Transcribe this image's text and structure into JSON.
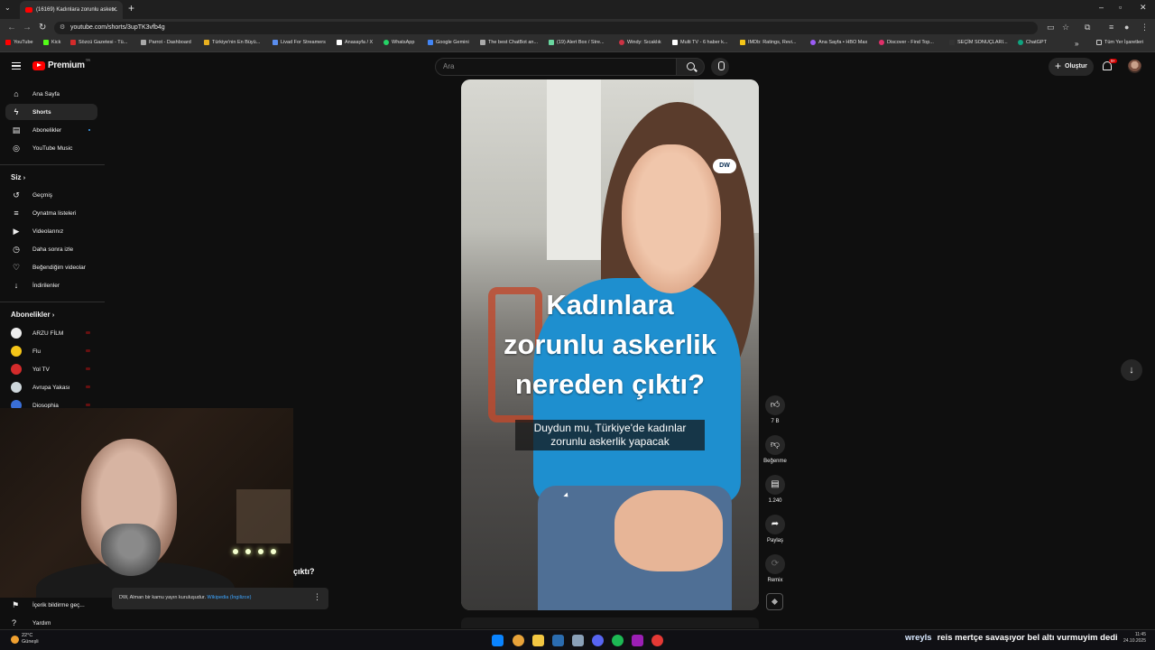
{
  "browser": {
    "tab_title": "(16169) Kadınlara zorunlu asker...",
    "url": "youtube.com/shorts/3upTK3vfb4g",
    "bookmarks": [
      "YouTube",
      "Kick",
      "Sözcü Gazetesi - Tü...",
      "Parrot - Dashboard",
      "Türkiye'nin En Büyü...",
      "Livad For Streamers",
      "Anasayfa / X",
      "WhatsApp",
      "Google Gemini",
      "The best ChatBot an...",
      "(19) Alert Box / Stre...",
      "Windy: Sıcaklık",
      "Multi TV - 6 haber k...",
      "IMDb: Ratings, Revi...",
      "Ana Sayfa • HBO Max",
      "Discover - Find Top...",
      "SEÇİM SONUÇLARI...",
      "ChatGPT"
    ],
    "all_bookmarks": "Tüm Yer İşaretleri",
    "bookmark_colors": [
      "#ff0000",
      "#53fc18",
      "#d42b2b",
      "#aaaaaa",
      "#e8b020",
      "#5a8dee",
      "#ffffff",
      "#25d366",
      "#4285f4",
      "#aaaaaa",
      "#6ad7a0",
      "#cc3344",
      "#ffffff",
      "#f5c518",
      "#9b5cf6",
      "#e0306a",
      "#333333",
      "#10a37f"
    ]
  },
  "header": {
    "logo_text": "Premium",
    "logo_tr": "TR",
    "search_placeholder": "Ara",
    "create_label": "Oluştur",
    "notif_count": "9+"
  },
  "sidebar": {
    "main_items": [
      {
        "label": "Ana Sayfa",
        "icon": "home-icon",
        "glyph": "⌂"
      },
      {
        "label": "Shorts",
        "icon": "shorts-icon",
        "glyph": "ϟ"
      },
      {
        "label": "Abonelikler",
        "icon": "subscriptions-icon",
        "glyph": "▤"
      },
      {
        "label": "YouTube Music",
        "icon": "music-icon",
        "glyph": "◎"
      }
    ],
    "you_heading": "Siz",
    "you_items": [
      {
        "label": "Geçmiş",
        "icon": "history-icon",
        "glyph": "↺"
      },
      {
        "label": "Oynatma listeleri",
        "icon": "playlist-icon",
        "glyph": "≡"
      },
      {
        "label": "Videolarınız",
        "icon": "your-videos-icon",
        "glyph": "▶"
      },
      {
        "label": "Daha sonra izle",
        "icon": "watch-later-icon",
        "glyph": "◷"
      },
      {
        "label": "Beğendiğim videolar",
        "icon": "liked-icon",
        "glyph": "♡"
      },
      {
        "label": "İndirilenler",
        "icon": "download-icon",
        "glyph": "↓"
      }
    ],
    "subs_heading": "Abonelikler",
    "channels": [
      {
        "label": "ARZU FİLM",
        "color": "#eeeeee"
      },
      {
        "label": "Flu",
        "color": "#f5c518"
      },
      {
        "label": "Yol TV",
        "color": "#d42b2b"
      },
      {
        "label": "Avrupa Yakası",
        "color": "#cfd8dc"
      },
      {
        "label": "Diosophia",
        "color": "#3a6fd8"
      }
    ],
    "bottom_items": [
      {
        "label": "İçerik bildirme geç...",
        "icon": "flag-icon",
        "glyph": "⚑"
      },
      {
        "label": "Yardım",
        "icon": "help-icon",
        "glyph": "?"
      }
    ]
  },
  "overlay": {
    "partial_title": "çıktı?",
    "wiki_text": "DW, Alman bir kamu yayın kuruluşudur.",
    "wiki_link": "Wikipedia (İngilizce)"
  },
  "short": {
    "title": "Kadınlara zorunlu askerlik nereden çıktı?",
    "title_lines": [
      "Kadınlara",
      "zorunlu askerlik",
      "nereden çıktı?"
    ],
    "subtitle_lines": [
      "Duydun mu, Türkiye'de kadınlar",
      "zorunlu askerlik yapacak"
    ],
    "logo": "DW"
  },
  "actions": {
    "like_count": "7 B",
    "dislike_label": "Beğenme",
    "comment_count": "1.240",
    "share_label": "Paylaş",
    "remix_label": "Remix"
  },
  "taskbar": {
    "temp": "22°C",
    "weather_label": "Güneşli",
    "ticker_user": "wreyls",
    "ticker_message": "reis mertçe savaşıyor bel altı vurmuyim dedi",
    "time": "11:45",
    "date": "24.10.2025",
    "icon_colors": [
      "#0a84ff",
      "#e8a33a",
      "#f3c742",
      "#2b6cb0",
      "#8aa0b8",
      "#5865f2",
      "#1db954",
      "#9b1fb5",
      "#e53935"
    ]
  }
}
